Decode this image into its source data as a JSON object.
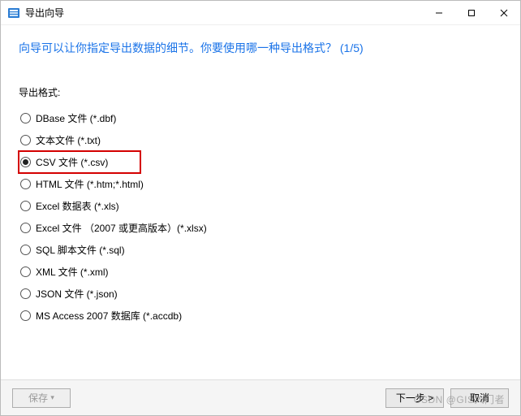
{
  "window": {
    "title": "导出向导"
  },
  "heading": "向导可以让你指定导出数据的细节。你要使用哪一种导出格式？  (1/5)",
  "form": {
    "label": "导出格式:",
    "options": [
      {
        "label": "DBase 文件 (*.dbf)",
        "selected": false,
        "highlight": false
      },
      {
        "label": "文本文件 (*.txt)",
        "selected": false,
        "highlight": false
      },
      {
        "label": "CSV 文件 (*.csv)",
        "selected": true,
        "highlight": true
      },
      {
        "label": "HTML 文件 (*.htm;*.html)",
        "selected": false,
        "highlight": false
      },
      {
        "label": "Excel 数据表 (*.xls)",
        "selected": false,
        "highlight": false
      },
      {
        "label": "Excel 文件 （2007 或更高版本）(*.xlsx)",
        "selected": false,
        "highlight": false
      },
      {
        "label": "SQL 脚本文件 (*.sql)",
        "selected": false,
        "highlight": false
      },
      {
        "label": "XML 文件 (*.xml)",
        "selected": false,
        "highlight": false
      },
      {
        "label": "JSON 文件 (*.json)",
        "selected": false,
        "highlight": false
      },
      {
        "label": "MS Access 2007 数据库 (*.accdb)",
        "selected": false,
        "highlight": false
      }
    ]
  },
  "footer": {
    "save": "保存",
    "next": "下一步 >",
    "cancel": "取消"
  },
  "watermark": "CSDN @GIS入门者"
}
